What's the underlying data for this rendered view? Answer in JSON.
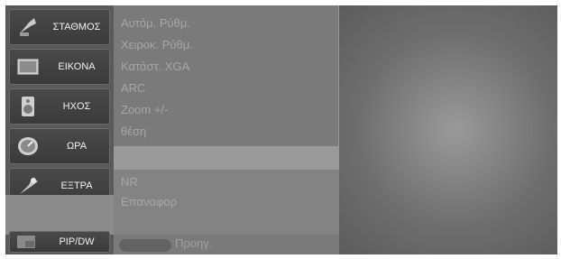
{
  "sidebar": {
    "items": [
      {
        "label": "ΣΤΑΘΜΟΣ",
        "icon": "antenna-icon"
      },
      {
        "label": "ΕΙΚΟΝΑ",
        "icon": "picture-icon"
      },
      {
        "label": "ΗΧΟΣ",
        "icon": "speaker-icon"
      },
      {
        "label": "ΩΡΑ",
        "icon": "clock-icon"
      },
      {
        "label": "ΕΞΤΡΑ",
        "icon": "extra-icon"
      },
      {
        "label": "PIP/DW",
        "icon": "pip-icon"
      }
    ]
  },
  "submenu": {
    "items": [
      "Αυτόμ. Ρύθμ.",
      "Χειροκ. Ρύθμ.",
      "Κατάστ. XGA",
      "ARC",
      "Zoom +/-",
      "θέση"
    ]
  },
  "submenu2": {
    "items": [
      "NR",
      "Επαναφορ"
    ]
  },
  "footer": {
    "prev_label": "Προηγ."
  }
}
